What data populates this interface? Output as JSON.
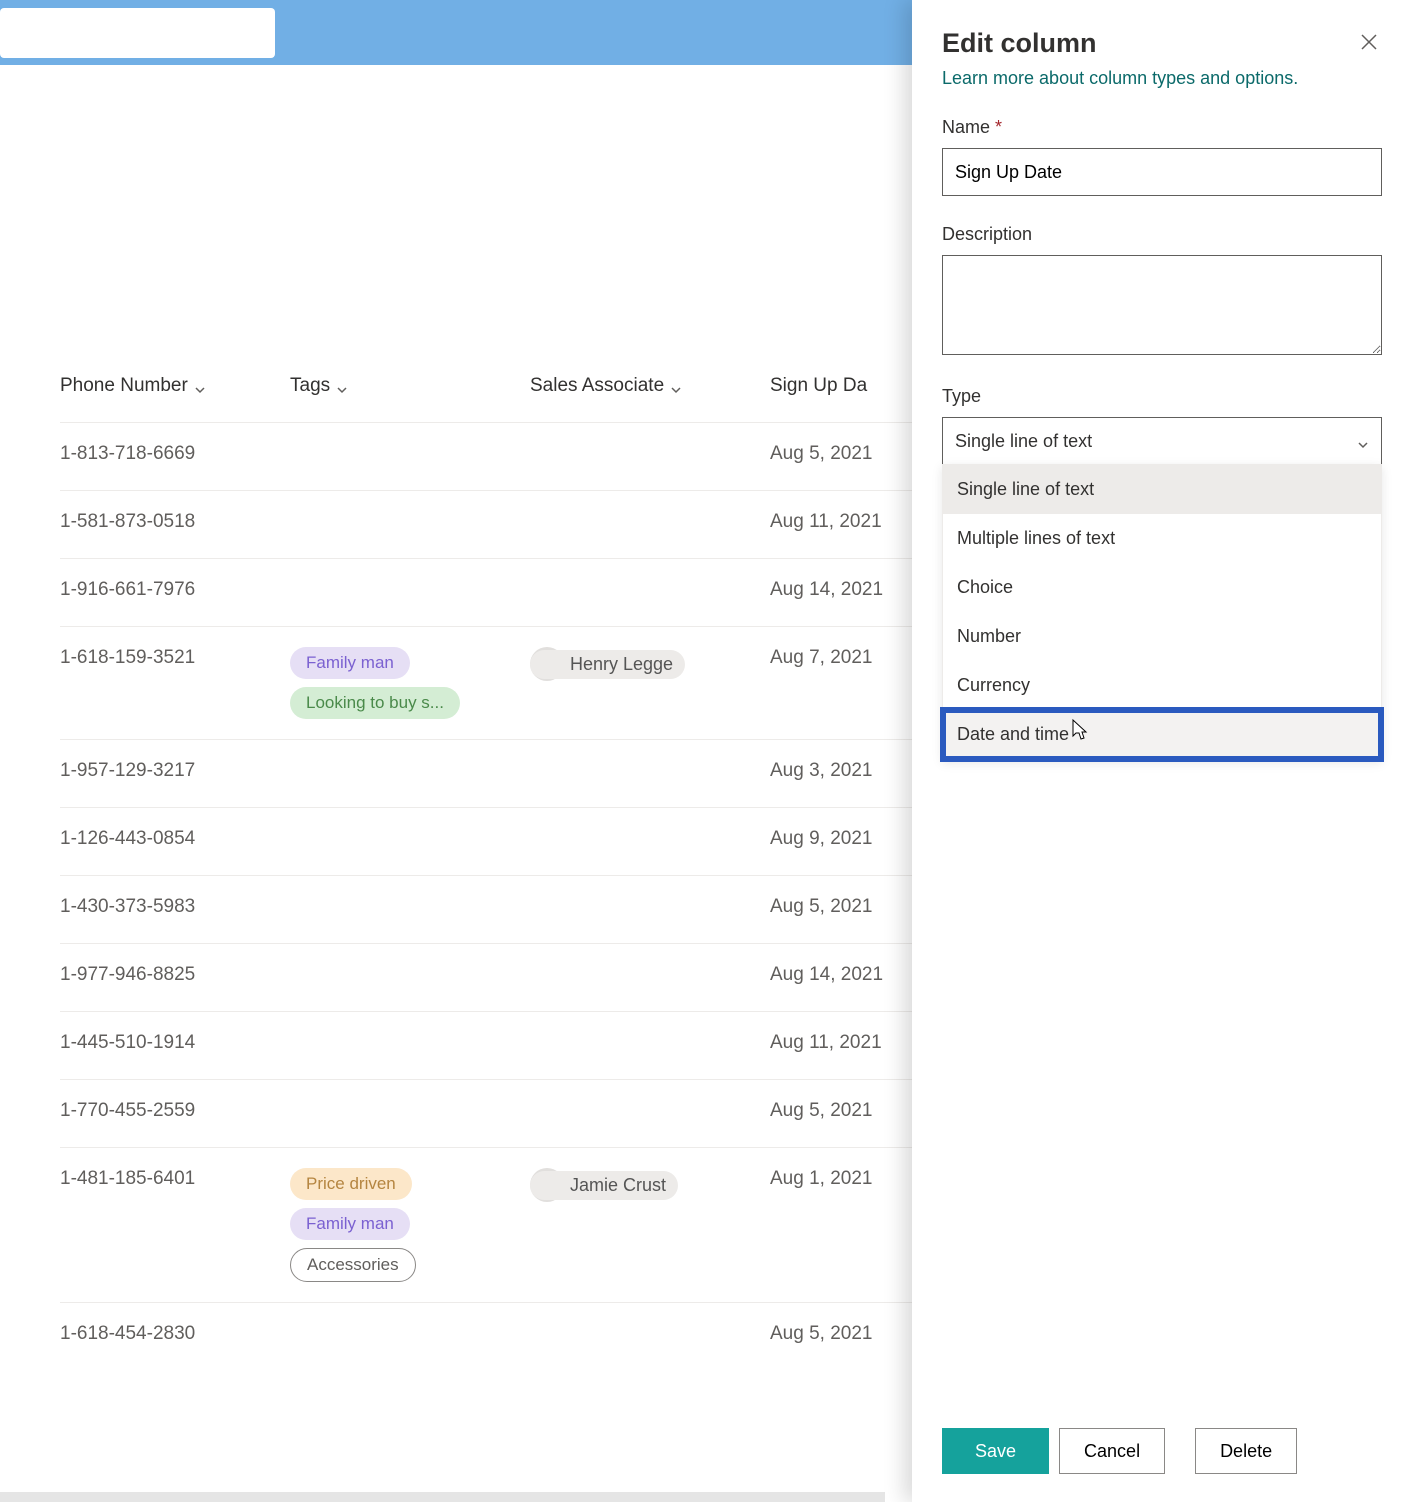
{
  "columns": {
    "phone": "Phone Number",
    "tags": "Tags",
    "sales": "Sales Associate",
    "signup": "Sign Up Da"
  },
  "rows": [
    {
      "phone": "1-813-718-6669",
      "tags": [],
      "sales": "",
      "signup": "Aug 5, 2021"
    },
    {
      "phone": "1-581-873-0518",
      "tags": [],
      "sales": "",
      "signup": "Aug 11, 2021"
    },
    {
      "phone": "1-916-661-7976",
      "tags": [],
      "sales": "",
      "signup": "Aug 14, 2021"
    },
    {
      "phone": "1-618-159-3521",
      "tags": [
        {
          "label": "Family man",
          "style": "purple"
        },
        {
          "label": "Looking to buy s...",
          "style": "green"
        }
      ],
      "sales": "Henry Legge",
      "signup": "Aug 7, 2021"
    },
    {
      "phone": "1-957-129-3217",
      "tags": [],
      "sales": "",
      "signup": "Aug 3, 2021"
    },
    {
      "phone": "1-126-443-0854",
      "tags": [],
      "sales": "",
      "signup": "Aug 9, 2021"
    },
    {
      "phone": "1-430-373-5983",
      "tags": [],
      "sales": "",
      "signup": "Aug 5, 2021"
    },
    {
      "phone": "1-977-946-8825",
      "tags": [],
      "sales": "",
      "signup": "Aug 14, 2021"
    },
    {
      "phone": "1-445-510-1914",
      "tags": [],
      "sales": "",
      "signup": "Aug 11, 2021"
    },
    {
      "phone": "1-770-455-2559",
      "tags": [],
      "sales": "",
      "signup": "Aug 5, 2021"
    },
    {
      "phone": "1-481-185-6401",
      "tags": [
        {
          "label": "Price driven",
          "style": "orange"
        },
        {
          "label": "Family man",
          "style": "purple"
        },
        {
          "label": "Accessories",
          "style": "outline"
        }
      ],
      "sales": "Jamie Crust",
      "signup": "Aug 1, 2021"
    },
    {
      "phone": "1-618-454-2830",
      "tags": [],
      "sales": "",
      "signup": "Aug 5, 2021"
    }
  ],
  "panel": {
    "title": "Edit column",
    "learn_link": "Learn more about column types and options.",
    "labels": {
      "name": "Name",
      "required": "*",
      "description": "Description",
      "type": "Type"
    },
    "name_value": "Sign Up Date",
    "description_value": "",
    "type_selected": "Single line of text",
    "type_options": [
      "Single line of text",
      "Multiple lines of text",
      "Choice",
      "Number",
      "Currency",
      "Date and time"
    ],
    "buttons": {
      "save": "Save",
      "cancel": "Cancel",
      "delete": "Delete"
    }
  }
}
